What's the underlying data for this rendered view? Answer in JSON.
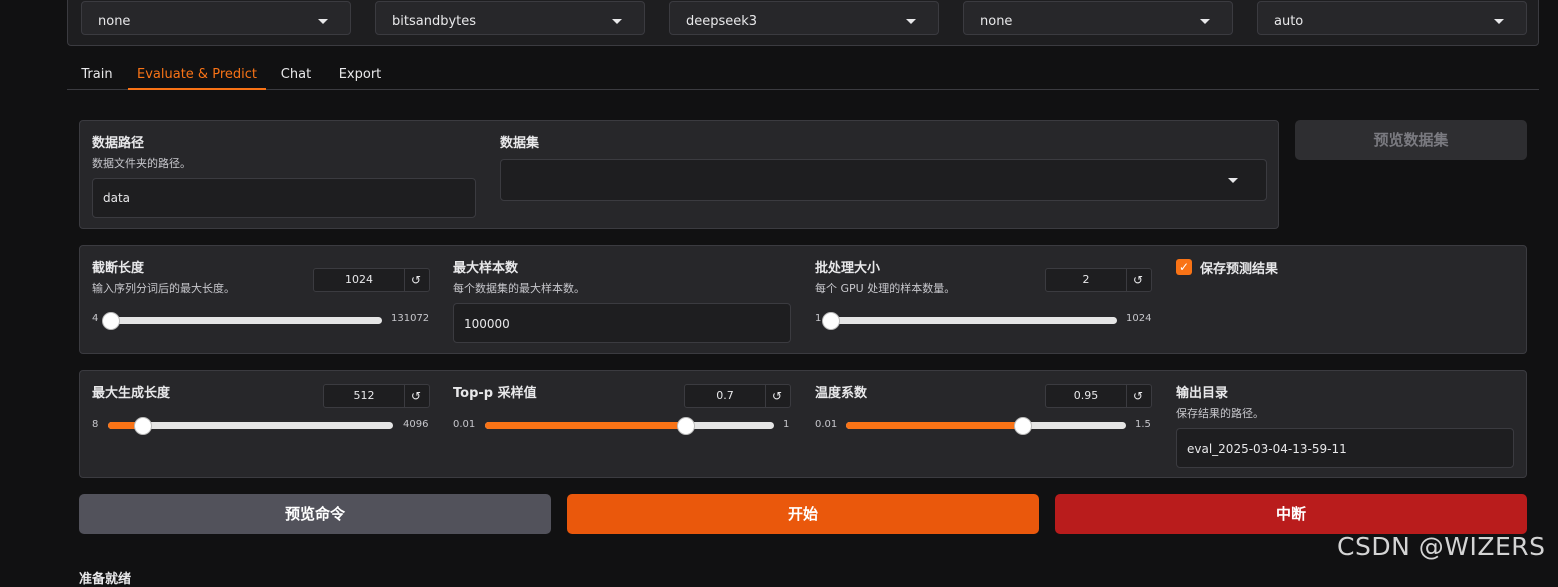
{
  "top_dropdowns": [
    {
      "value": "none"
    },
    {
      "value": "bitsandbytes"
    },
    {
      "value": "deepseek3"
    },
    {
      "value": "none"
    },
    {
      "value": "auto"
    }
  ],
  "tabs": [
    {
      "label": "Train"
    },
    {
      "label": "Evaluate & Predict",
      "active": true
    },
    {
      "label": "Chat"
    },
    {
      "label": "Export"
    }
  ],
  "data_section": {
    "path_label": "数据路径",
    "path_desc": "数据文件夹的路径。",
    "path_value": "data",
    "dataset_label": "数据集",
    "dataset_value": "",
    "preview_button": "预览数据集"
  },
  "row1": {
    "cutoff": {
      "label": "截断长度",
      "desc": "输入序列分词后的最大长度。",
      "value": "1024",
      "min": "4",
      "max": "131072",
      "fraction": 0.0078
    },
    "max_samples": {
      "label": "最大样本数",
      "desc": "每个数据集的最大样本数。",
      "value": "100000"
    },
    "batch": {
      "label": "批处理大小",
      "desc": "每个 GPU 处理的样本数量。",
      "value": "2",
      "min": "1",
      "max": "1024",
      "fraction": 0.001
    },
    "save_predictions": {
      "label": "保存预测结果",
      "checked": true
    }
  },
  "row2": {
    "max_new_tokens": {
      "label": "最大生成长度",
      "value": "512",
      "min": "8",
      "max": "4096",
      "fraction": 0.1233
    },
    "top_p": {
      "label": "Top-p 采样值",
      "value": "0.7",
      "min": "0.01",
      "max": "1",
      "fraction": 0.697
    },
    "temperature": {
      "label": "温度系数",
      "value": "0.95",
      "min": "0.01",
      "max": "1.5",
      "fraction": 0.6309
    },
    "output_dir": {
      "label": "输出目录",
      "desc": "保存结果的路径。",
      "value": "eval_2025-03-04-13-59-11"
    }
  },
  "reset_glyph": "↺",
  "buttons": {
    "preview_cmd": "预览命令",
    "start": "开始",
    "abort": "中断"
  },
  "footer_partial": "准备就绪",
  "watermark": "CSDN @WIZERS",
  "colors": {
    "accent": "#f97316",
    "start": "#ea580c",
    "abort": "#b91c1c",
    "preview": "#52525b"
  }
}
